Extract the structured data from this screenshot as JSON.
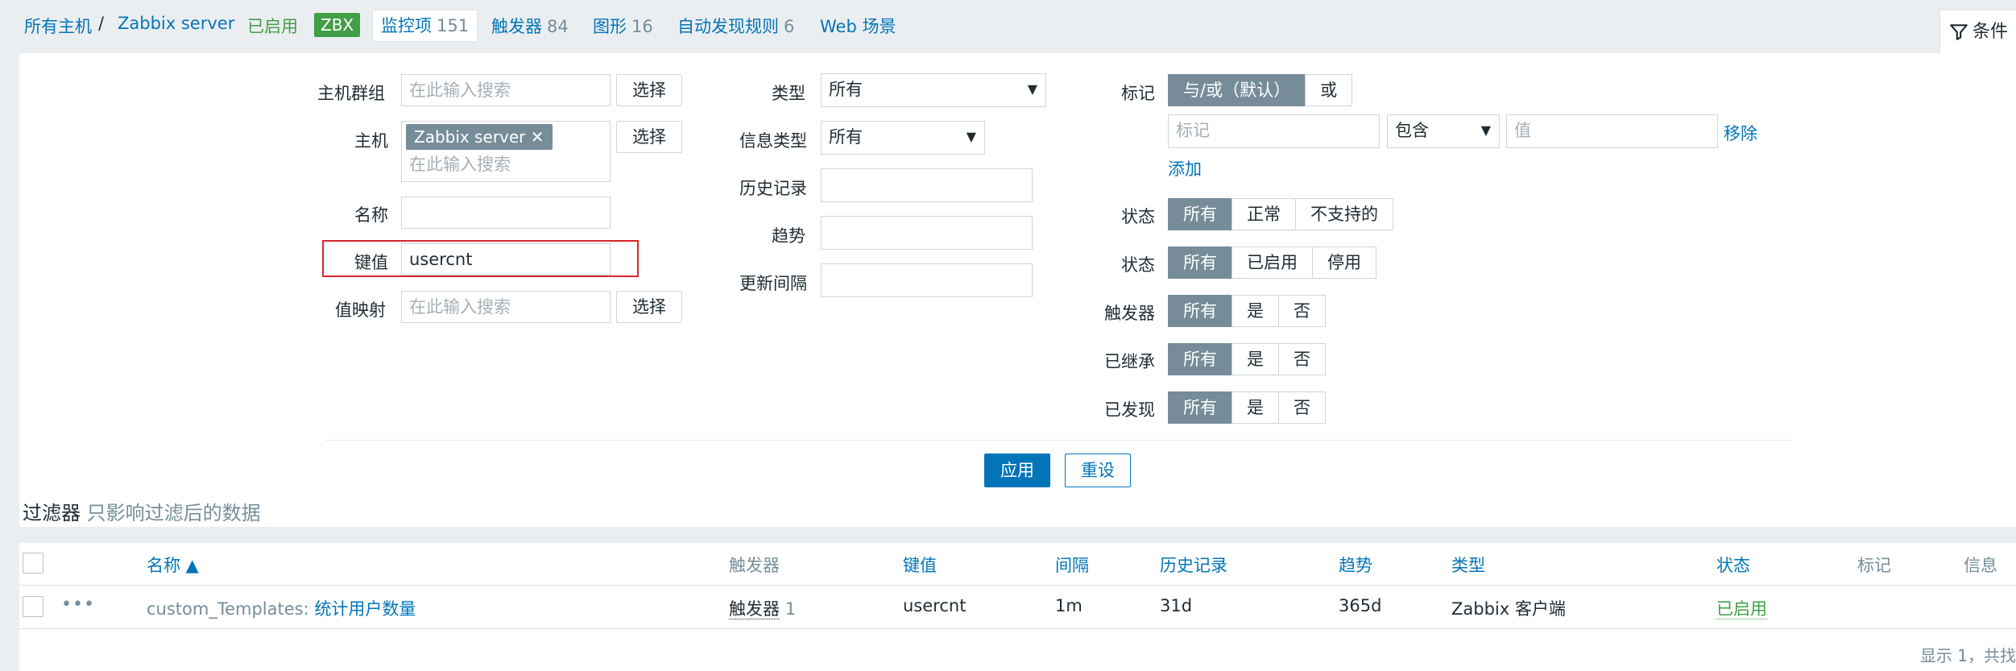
{
  "nav": {
    "all_hosts": "所有主机",
    "sep": "/",
    "host": "Zabbix server",
    "enabled": "已启用",
    "zbx": "ZBX",
    "items_label": "监控项",
    "items_count": "151",
    "triggers_label": "触发器",
    "triggers_count": "84",
    "graphs_label": "图形",
    "graphs_count": "16",
    "discovery_label": "自动发现规则",
    "discovery_count": "6",
    "web_label": "Web 场景",
    "filter_tab": "条件"
  },
  "filter": {
    "host_groups_label": "主机群组",
    "host_groups_placeholder": "在此输入搜索",
    "select_label": "选择",
    "host_label": "主机",
    "host_chip": "Zabbix server",
    "host_placeholder": "在此输入搜索",
    "name_label": "名称",
    "name_value": "",
    "key_label": "键值",
    "key_value": "usercnt",
    "valuemap_label": "值映射",
    "valuemap_placeholder": "在此输入搜索",
    "type_label": "类型",
    "type_value": "所有",
    "info_type_label": "信息类型",
    "info_type_value": "所有",
    "history_label": "历史记录",
    "trends_label": "趋势",
    "interval_label": "更新间隔",
    "tags_label": "标记",
    "tags_andor": "与/或（默认）",
    "tags_or": "或",
    "tag_placeholder": "标记",
    "tag_op": "包含",
    "tag_value_placeholder": "值",
    "remove": "移除",
    "add": "添加",
    "state_label": "状态",
    "state_options": [
      "所有",
      "正常",
      "不支持的"
    ],
    "status_label": "状态",
    "status_options": [
      "所有",
      "已启用",
      "停用"
    ],
    "triggers_label": "触发器",
    "yesno_options": [
      "所有",
      "是",
      "否"
    ],
    "inherited_label": "已继承",
    "discovered_label": "已发现",
    "apply": "应用",
    "reset": "重设"
  },
  "filter_info": {
    "title": "过滤器",
    "subtitle": "只影响过滤后的数据"
  },
  "table": {
    "headers": {
      "name": "名称 ▲",
      "triggers": "触发器",
      "key": "键值",
      "interval": "间隔",
      "history": "历史记录",
      "trends": "趋势",
      "type": "类型",
      "status": "状态",
      "tags": "标记",
      "info": "信息"
    },
    "rows": [
      {
        "name_prefix": "custom_Templates",
        "name": "统计用户数量",
        "triggers_label": "触发器",
        "triggers_count": "1",
        "key": "usercnt",
        "interval": "1m",
        "history": "31d",
        "trends": "365d",
        "type": "Zabbix 客户端",
        "status": "已启用"
      }
    ],
    "footer": "显示 1，共找"
  },
  "colors": {
    "link": "#0275b8",
    "green": "#429e47",
    "segment_active": "#768d99",
    "highlight": "#d9262c"
  }
}
